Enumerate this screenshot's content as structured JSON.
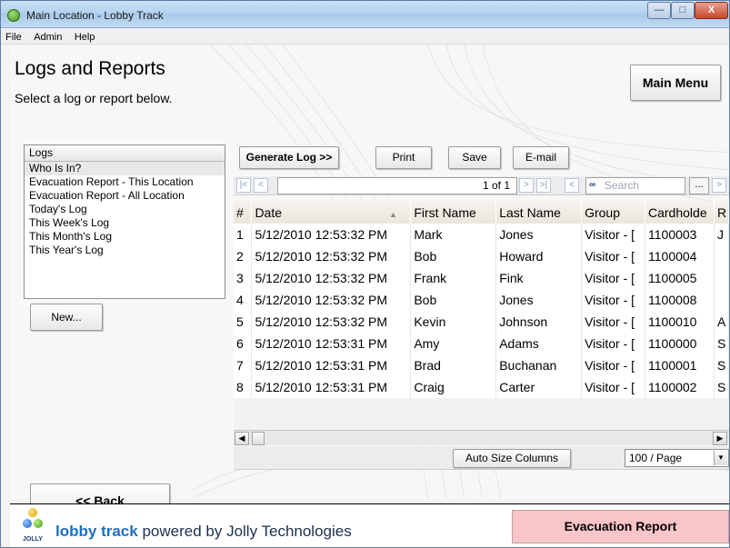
{
  "window": {
    "title": "Main Location - Lobby Track",
    "minimize_label": "—",
    "maximize_label": "□",
    "close_label": "X"
  },
  "menu": {
    "items": [
      "File",
      "Admin",
      "Help"
    ]
  },
  "header": {
    "title": "Logs and Reports",
    "subtitle": "Select a log or report below.",
    "main_menu_label": "Main Menu"
  },
  "logs": {
    "header": "Logs",
    "selected_index": 0,
    "items": [
      "Who Is In?",
      "Evacuation Report - This Location",
      "Evacuation Report - All Location",
      "Today's Log",
      "This Week's Log",
      "This Month's Log",
      "This Year's Log"
    ],
    "new_label": "New..."
  },
  "toolbar": {
    "generate_label": "Generate Log >>",
    "print_label": "Print",
    "save_label": "Save",
    "email_label": "E-mail"
  },
  "navigation": {
    "page_info": "1 of 1",
    "search_placeholder": "Search",
    "more_label": "..."
  },
  "grid": {
    "columns": [
      "#",
      "Date",
      "First Name",
      "Last Name",
      "Group",
      "Cardholde",
      "R"
    ],
    "sorted_column": "Date",
    "rows": [
      {
        "num": "1",
        "date": "5/12/2010 12:53:32 PM",
        "first": "Mark",
        "last": "Jones",
        "group": "Visitor - [",
        "card": "1100003",
        "r": "J"
      },
      {
        "num": "2",
        "date": "5/12/2010 12:53:32 PM",
        "first": "Bob",
        "last": "Howard",
        "group": "Visitor - [",
        "card": "1100004",
        "r": ""
      },
      {
        "num": "3",
        "date": "5/12/2010 12:53:32 PM",
        "first": "Frank",
        "last": "Fink",
        "group": "Visitor - [",
        "card": "1100005",
        "r": ""
      },
      {
        "num": "4",
        "date": "5/12/2010 12:53:32 PM",
        "first": "Bob",
        "last": "Jones",
        "group": "Visitor - [",
        "card": "1100008",
        "r": ""
      },
      {
        "num": "5",
        "date": "5/12/2010 12:53:32 PM",
        "first": "Kevin",
        "last": "Johnson",
        "group": "Visitor - [",
        "card": "1100010",
        "r": "A"
      },
      {
        "num": "6",
        "date": "5/12/2010 12:53:31 PM",
        "first": "Amy",
        "last": "Adams",
        "group": "Visitor - [",
        "card": "1100000",
        "r": "S"
      },
      {
        "num": "7",
        "date": "5/12/2010 12:53:31 PM",
        "first": "Brad",
        "last": "Buchanan",
        "group": "Visitor - [",
        "card": "1100001",
        "r": "S"
      },
      {
        "num": "8",
        "date": "5/12/2010 12:53:31 PM",
        "first": "Craig",
        "last": "Carter",
        "group": "Visitor - [",
        "card": "1100002",
        "r": "S"
      }
    ],
    "auto_size_label": "Auto Size Columns",
    "per_page_value": "100 / Page"
  },
  "back_label": "<< Back",
  "footer": {
    "logo_jolly": "JOLLY",
    "logo_lobby": "lobby",
    "logo_track": "track",
    "logo_rest": "powered by Jolly Technologies",
    "evacuation_label": "Evacuation Report"
  },
  "colors": {
    "accent": "#1d6fc2",
    "evacuation_bg": "#f9c5c8",
    "title_bar": "#b5d3ef"
  }
}
